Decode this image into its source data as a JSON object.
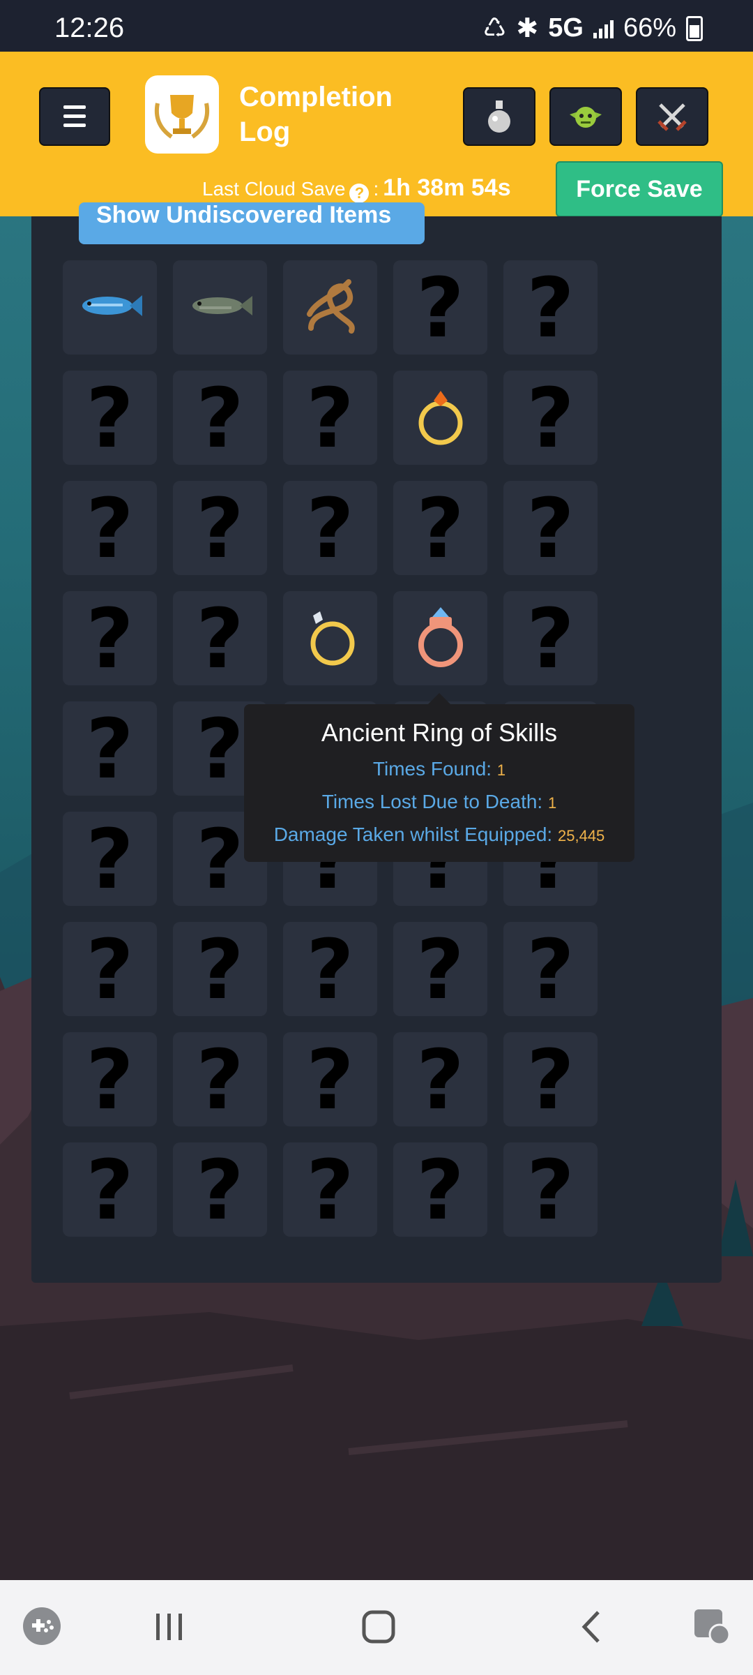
{
  "status_bar": {
    "time": "12:26",
    "network": "5G",
    "battery": "66%"
  },
  "header": {
    "title": "Completion Log",
    "cloud_save_label": "Last Cloud Save",
    "cloud_save_sep": ":",
    "cloud_save_time": "1h 38m 54s",
    "force_save_label": "Force Save",
    "buttons": [
      "potion-icon",
      "goblin-icon",
      "crossed-swords-icon"
    ]
  },
  "panel": {
    "undiscovered_label": "Show Undiscovered Items",
    "question_glyph": "?",
    "items": [
      "fish-blue-icon",
      "fish-green-icon",
      "rope-knot-icon",
      "unknown",
      "unknown",
      "unknown",
      "unknown",
      "unknown",
      "fire-ring-icon",
      "unknown",
      "unknown",
      "unknown",
      "unknown",
      "unknown",
      "unknown",
      "unknown",
      "unknown",
      "diamond-ring-icon",
      "ancient-ring-icon",
      "unknown",
      "unknown",
      "unknown",
      "unknown",
      "unknown",
      "unknown",
      "unknown",
      "unknown",
      "unknown",
      "unknown",
      "unknown",
      "unknown",
      "unknown",
      "unknown",
      "unknown",
      "unknown",
      "unknown",
      "unknown",
      "unknown",
      "unknown",
      "unknown",
      "unknown",
      "unknown",
      "unknown",
      "unknown",
      "unknown"
    ]
  },
  "tooltip": {
    "title": "Ancient Ring of Skills",
    "times_found_label": "Times Found:",
    "times_found": "1",
    "times_lost_label": "Times Lost Due to Death:",
    "times_lost": "1",
    "damage_label": "Damage Taken whilst Equipped:",
    "damage": "25,445"
  },
  "colors": {
    "header": "#fbbd23",
    "force_save": "#2fbe86",
    "panel": "#222833",
    "tooltip_label": "#5aa9e6",
    "tooltip_value": "#f0b34a"
  },
  "navbar": [
    "game-launcher-icon",
    "recent-apps-icon",
    "home-icon",
    "back-icon",
    "assistant-icon"
  ]
}
